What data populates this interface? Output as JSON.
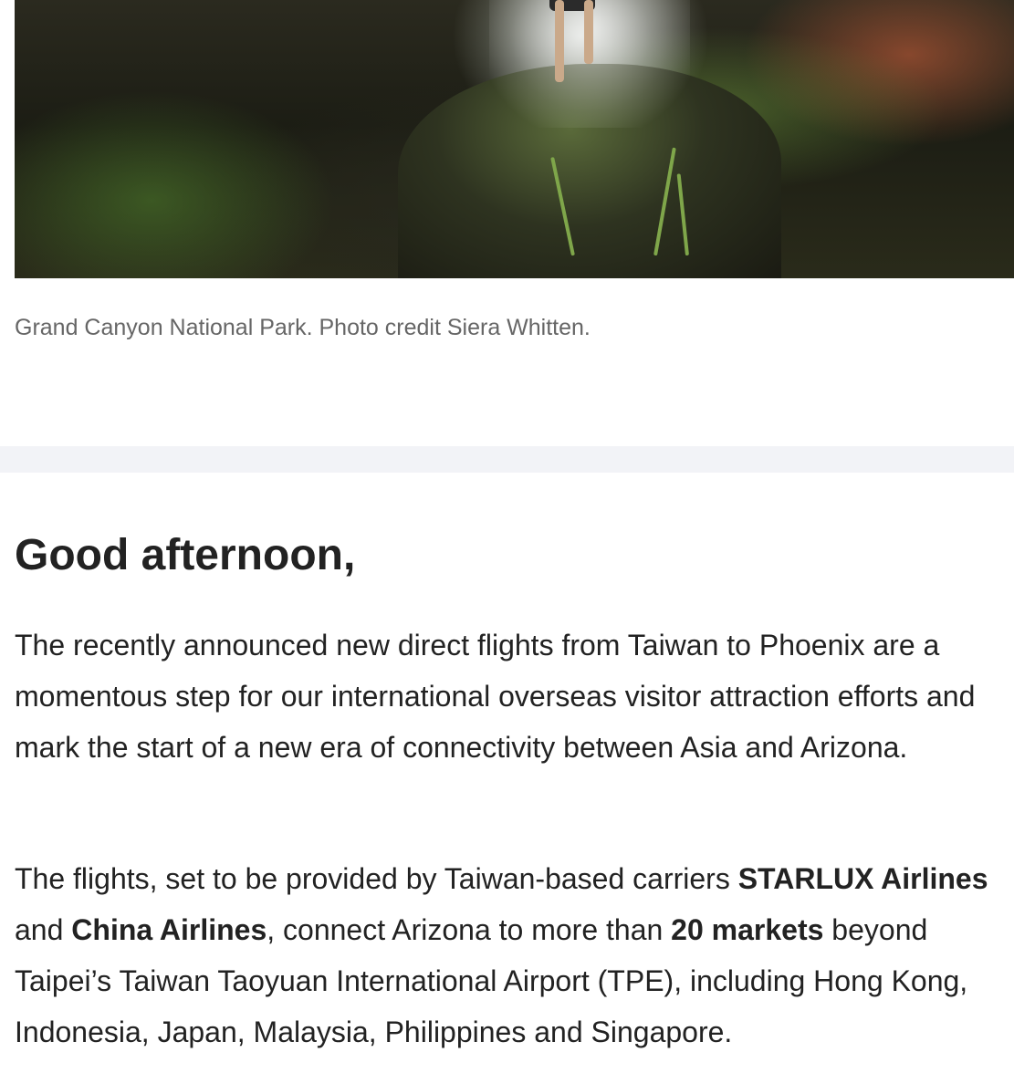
{
  "hero_image": {
    "description_icon": "canyon-waterfall-photo"
  },
  "caption": "Grand Canyon National Park. Photo credit Siera Whitten.",
  "greeting": "Good afternoon,",
  "paragraph1": "The recently announced new direct flights from Taiwan to Phoenix are a momentous step for our international overseas visitor attraction efforts and mark the start of a new era of connectivity between Asia and Arizona.",
  "paragraph2": {
    "t1": "The flights, set to be provided by Taiwan-based carriers ",
    "b1": "STARLUX Airlines",
    "t2": " and ",
    "b2": "China Airlines",
    "t3": ", connect Arizona to more than ",
    "b3": "20 markets",
    "t4": " beyond Taipei’s Taiwan Taoyuan International Airport (TPE), including Hong Kong, Indonesia, Japan, Malaysia, Philippines and Singapore."
  },
  "colors": {
    "text": "#222222",
    "caption": "#666666",
    "band": "#f2f3f7"
  }
}
